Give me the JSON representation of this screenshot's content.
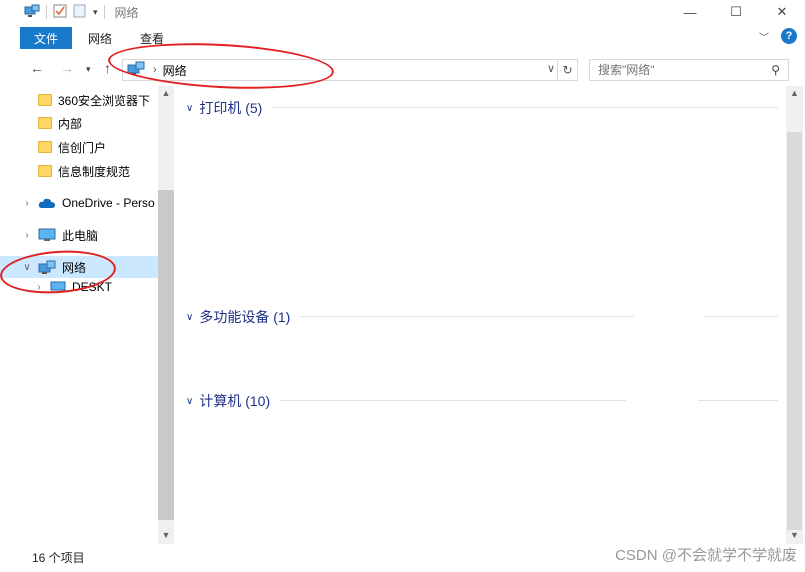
{
  "window": {
    "title": "网络"
  },
  "ribbon": {
    "tabs": [
      "文件",
      "网络",
      "查看"
    ]
  },
  "address": {
    "crumb": "网络"
  },
  "search": {
    "placeholder": "搜索\"网络\""
  },
  "sidebar": {
    "folders": [
      "360安全浏览器下",
      "内部",
      "信创门户",
      "信息制度规范"
    ],
    "onedrive": "OneDrive - Perso",
    "this_pc": "此电脑",
    "network": "网络",
    "desktop_child": "DESKT"
  },
  "main": {
    "groups": [
      {
        "label": "打印机 (5)"
      },
      {
        "label": "多功能设备 (1)"
      },
      {
        "label": "计算机 (10)"
      }
    ]
  },
  "status": {
    "item_count": "16 个项目"
  },
  "watermark": "CSDN @不会就学不学就废",
  "colors": {
    "accent": "#1979ca",
    "group_header": "#1e3287",
    "selection": "#cce8ff",
    "annotation": "#e02020"
  }
}
